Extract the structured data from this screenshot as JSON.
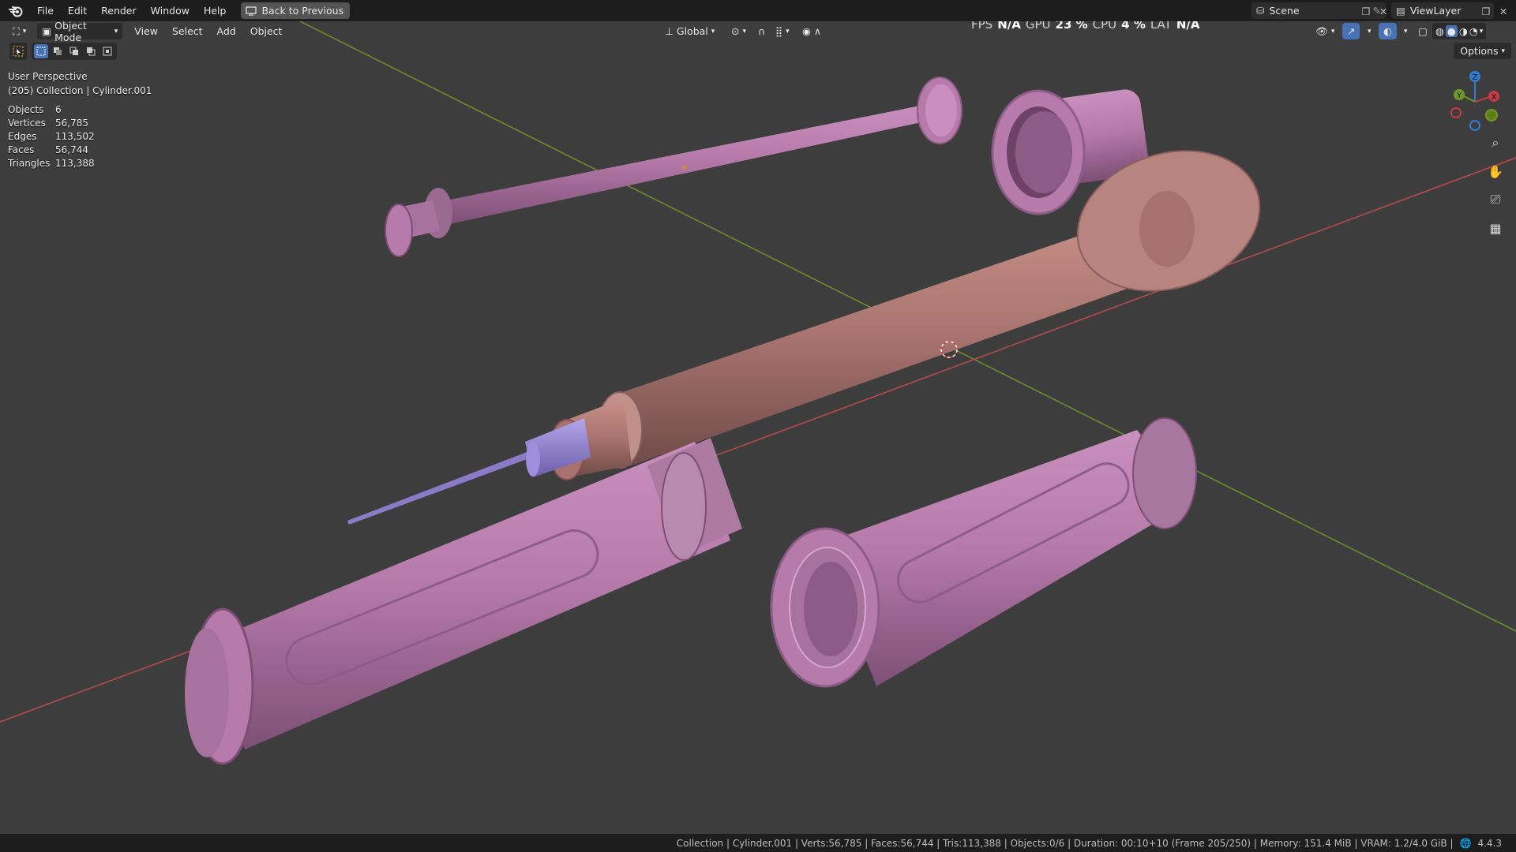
{
  "topbar": {
    "menus": [
      "File",
      "Edit",
      "Render",
      "Window",
      "Help"
    ],
    "back_button": "Back to Previous",
    "scene_name": "Scene",
    "view_layer": "ViewLayer"
  },
  "perf": {
    "fps_label": "FPS",
    "fps_value": "N/A",
    "gpu_label": "GPU",
    "gpu_value": "23 %",
    "cpu_label": "CPU",
    "cpu_value": "4 %",
    "lat_label": "LAT",
    "lat_value": "N/A"
  },
  "viewport_header": {
    "mode": "Object Mode",
    "menus": [
      "View",
      "Select",
      "Add",
      "Object"
    ],
    "transform_orientation": "Global",
    "options": "Options"
  },
  "overlay": {
    "view_name": "User Perspective",
    "context": "(205) Collection | Cylinder.001"
  },
  "stats": [
    {
      "label": "Objects",
      "value": "6"
    },
    {
      "label": "Vertices",
      "value": "56,785"
    },
    {
      "label": "Edges",
      "value": "113,502"
    },
    {
      "label": "Faces",
      "value": "56,744"
    },
    {
      "label": "Triangles",
      "value": "113,388"
    }
  ],
  "gizmo": {
    "x": "X",
    "y": "Y",
    "z": "Z"
  },
  "statusbar": {
    "text": "Collection | Cylinder.001 | Verts:56,785 | Faces:56,744 | Tris:113,388 | Objects:0/6 | Duration: 00:10+10 (Frame 205/250) | Memory: 151.4 MiB | VRAM: 1.2/4.0 GiB |",
    "version": "4.4.3"
  },
  "colors": {
    "pink": "#b77bab",
    "salmon": "#b07b76",
    "needle": "#8a7bc6",
    "axis_x": "#b54a52",
    "axis_y": "#6e8c2b"
  }
}
